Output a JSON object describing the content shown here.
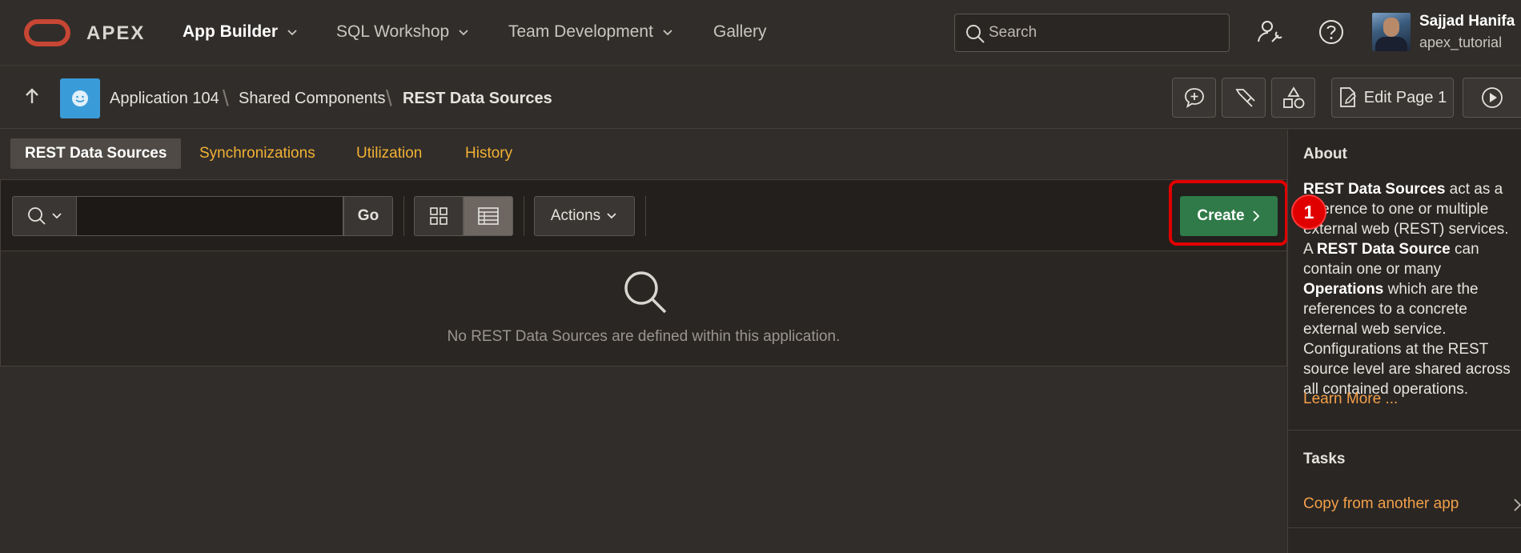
{
  "header": {
    "brand": "APEX",
    "nav": [
      {
        "label": "App Builder",
        "active": true
      },
      {
        "label": "SQL Workshop",
        "active": false
      },
      {
        "label": "Team Development",
        "active": false
      },
      {
        "label": "Gallery",
        "active": false
      }
    ],
    "search_placeholder": "Search",
    "user": {
      "name": "Sajjad Hanifa",
      "id": "apex_tutorial"
    }
  },
  "breadcrumb": {
    "items": [
      "Application 104",
      "Shared Components",
      "REST Data Sources"
    ]
  },
  "toolbar_right": {
    "edit_page_label": "Edit Page 1"
  },
  "tabs": [
    "REST Data Sources",
    "Synchronizations",
    "Utilization",
    "History"
  ],
  "report": {
    "go_label": "Go",
    "actions_label": "Actions",
    "create_label": "Create",
    "empty_message": "No REST Data Sources are defined within this application.",
    "annotation_number": "1"
  },
  "sidebar": {
    "about_title": "About",
    "about_bold_1": "REST Data Sources",
    "about_text_1": " act as a reference to one or multiple external web (REST) services. A ",
    "about_bold_2": "REST Data Source",
    "about_text_2": " can contain one or many ",
    "about_bold_3": "Operations",
    "about_text_3": " which are the references to a concrete external web service. Configurations at the REST source level are shared across all contained operations.",
    "learn_more": "Learn More ...",
    "tasks_title": "Tasks",
    "task_link": "Copy from another app"
  },
  "colors": {
    "background": "#312d2a",
    "accent_link": "#f2b134",
    "create_button": "#2f7a48",
    "annotation": "#e00000"
  }
}
